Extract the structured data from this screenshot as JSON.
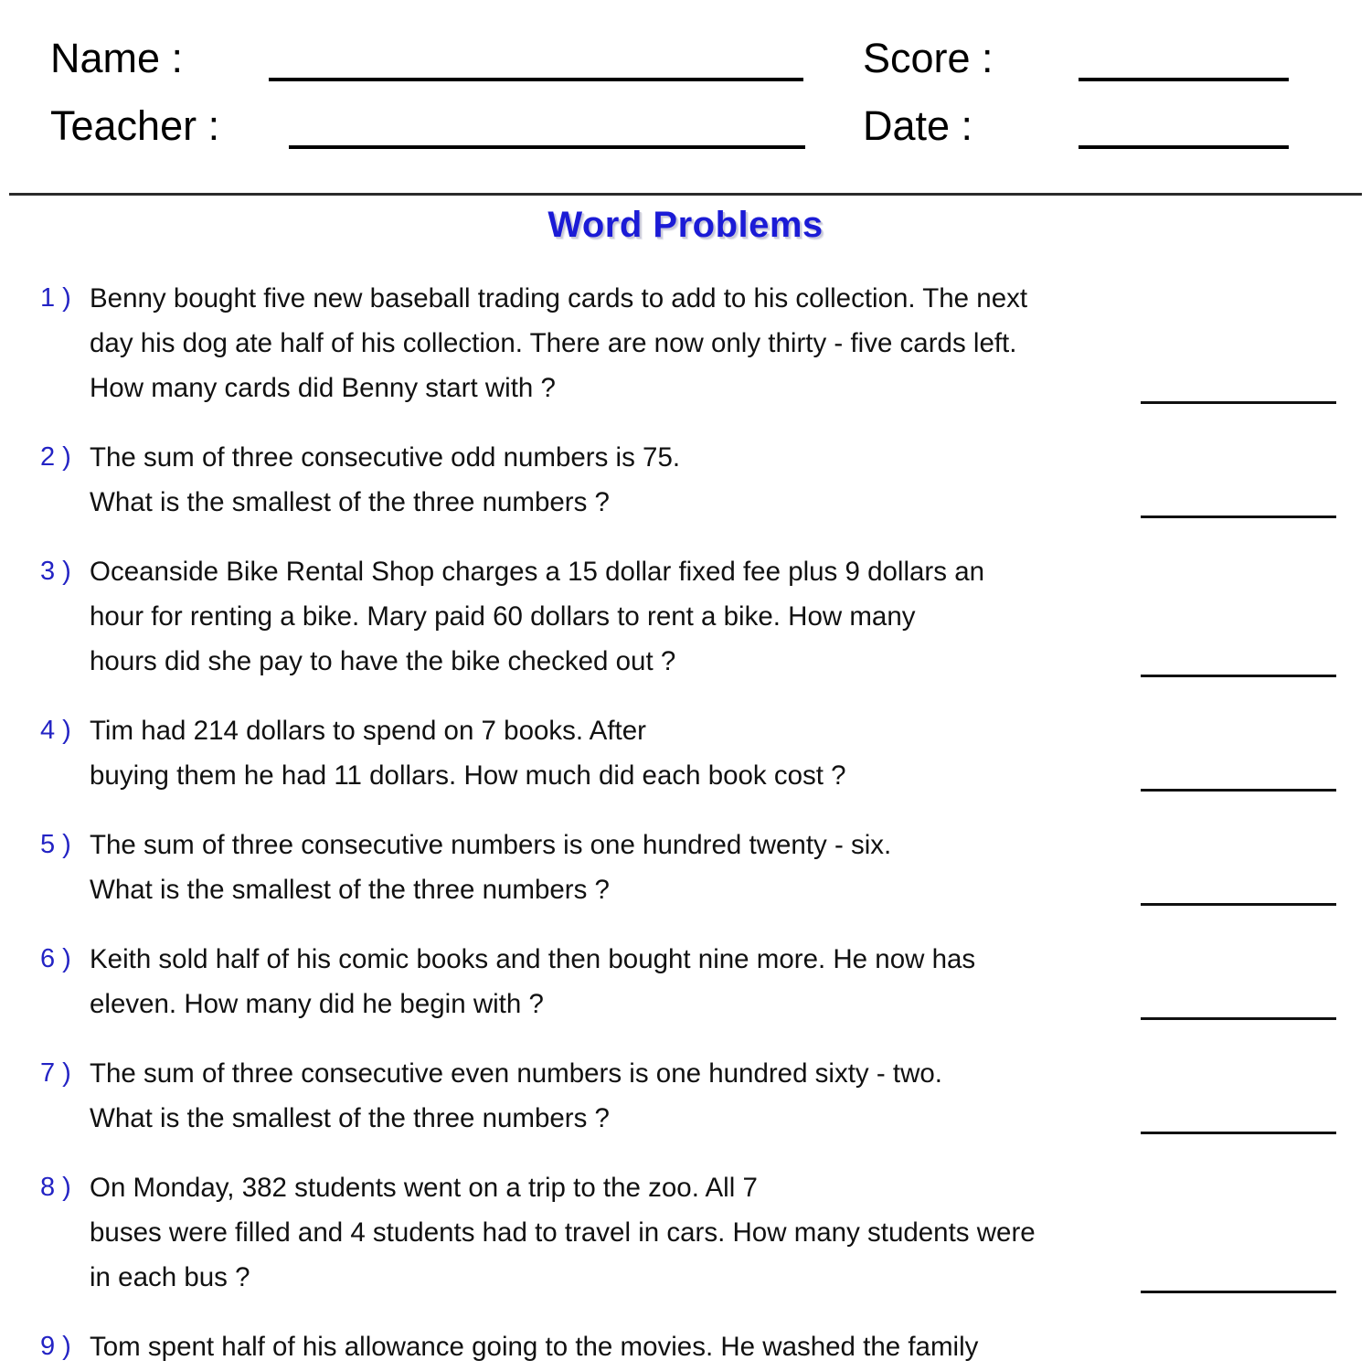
{
  "header": {
    "name_label": "Name :",
    "teacher_label": "Teacher :",
    "score_label": "Score :",
    "date_label": "Date :"
  },
  "title": "Word Problems",
  "colors": {
    "title_blue": "#1b1bd6",
    "number_blue": "#2323c4",
    "body_text": "#111111",
    "rule_black": "#000000",
    "page_background": "#ffffff"
  },
  "problems": [
    {
      "number": "1 )",
      "lines": [
        "Benny bought five new baseball trading cards to add to his collection. The next",
        "day his dog ate half of his collection. There are now only thirty - five cards left.",
        "How many cards did Benny start with ?"
      ]
    },
    {
      "number": "2 )",
      "lines": [
        "The sum of three consecutive odd numbers is 75.",
        "What is the smallest of the three numbers ?"
      ]
    },
    {
      "number": "3 )",
      "lines": [
        "Oceanside Bike Rental Shop charges a 15 dollar fixed fee plus 9 dollars an",
        "hour for renting a bike. Mary paid 60 dollars to rent a bike. How many",
        "hours did she pay to have the bike checked out ?"
      ]
    },
    {
      "number": "4 )",
      "lines": [
        "Tim had 214 dollars to spend on 7 books. After",
        "buying them he had 11 dollars. How much did each book cost ?"
      ]
    },
    {
      "number": "5 )",
      "lines": [
        "The sum of three consecutive numbers is one hundred  twenty - six.",
        "What is the smallest of the three numbers ?"
      ]
    },
    {
      "number": "6 )",
      "lines": [
        "Keith sold half of his comic books and then bought nine more. He now has",
        "eleven. How many did he begin with ?"
      ]
    },
    {
      "number": "7 )",
      "lines": [
        "The sum of three consecutive even numbers is one hundred  sixty - two.",
        "What is the smallest of the three numbers ?"
      ]
    },
    {
      "number": "8 )",
      "lines": [
        "On Monday, 382 students went on a trip to the zoo. All 7",
        "buses were filled and 4 students had to travel in cars. How many students were",
        "in each bus ?"
      ]
    },
    {
      "number": "9 )",
      "lines": [
        "Tom spent half of his allowance going to the movies. He washed the family"
      ]
    }
  ],
  "answer_blank_count": 8
}
